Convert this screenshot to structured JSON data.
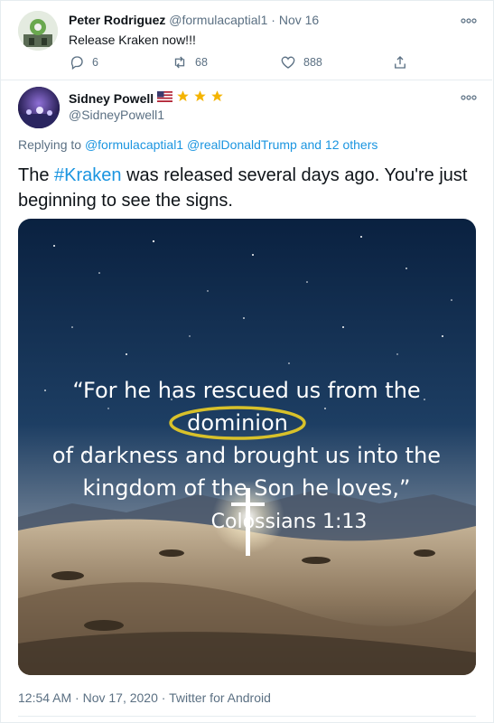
{
  "reply_tweet": {
    "display_name": "Peter Rodriguez",
    "handle": "@formulacaptial1",
    "separator": "·",
    "date": "Nov 16",
    "text": "Release Kraken now!!!",
    "more_icon": "more-horizontal-icon",
    "stats": {
      "replies": "6",
      "retweets": "68",
      "likes": "888"
    }
  },
  "main_tweet": {
    "display_name": "Sidney Powell",
    "name_emoji": [
      "us-flag-icon",
      "star-icon",
      "star-icon",
      "star-icon"
    ],
    "handle": "@SidneyPowell1",
    "more_icon": "more-horizontal-icon",
    "replying_prefix": "Replying to",
    "replying_user1": "@formulacaptial1",
    "replying_user2": "@realDonaldTrump",
    "replying_rest": "and 12 others",
    "text_before": "The",
    "hashtag": "#Kraken",
    "text_after": "was released several days ago. You're just beginning to see the signs.",
    "media": {
      "quote_line1": "“For he has rescued us from the",
      "quote_line2": "dominion",
      "quote_line3": "of darkness and brought us into the",
      "quote_line4": "kingdom of the Son he loves,”",
      "quote_ref": "Colossians 1:13"
    },
    "timestamp": "12:54 AM · Nov 17, 2020 · Twitter for Android"
  },
  "colors": {
    "link": "#1b95e0",
    "muted": "#5b7083",
    "star": "#f4b400",
    "highlight_circle": "#d8c12a"
  }
}
